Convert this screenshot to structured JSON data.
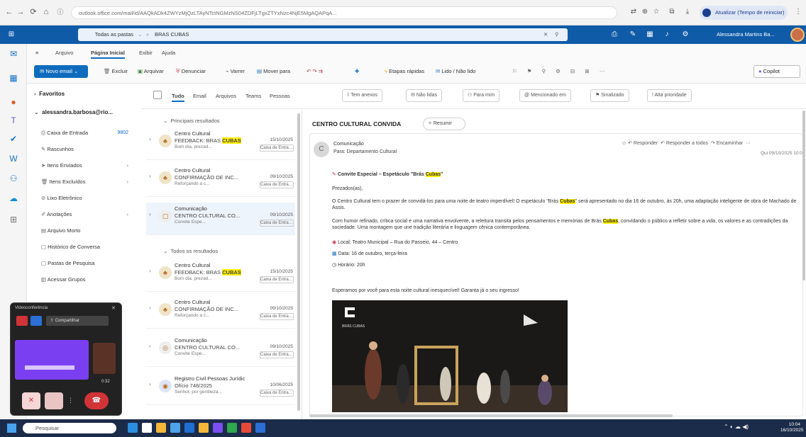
{
  "browser": {
    "nav": {
      "back": "←",
      "forward": "→",
      "reload": "⟳",
      "home": "⌂"
    },
    "address": "outlook.office.com/mail/id/AAQkADk4ZWYzMjQzLTAyNTctNGMzNS04ZDFjLTgxZTYxNzc4NjE5MgAQAPqA...",
    "profile": "Atualizar (Tempo de reiniciar)"
  },
  "header": {
    "search_placeholder": "Todas as pastas",
    "search_query": "BRAS CUBAS",
    "user": "Alessandra Martins Ba..."
  },
  "ribbon": {
    "tabs": [
      "Arquivo",
      "Página Inicial",
      "Exibir",
      "Ajuda"
    ],
    "active_tab": "Página Inicial",
    "new_mail": "Novo email",
    "buttons": [
      "Excluir",
      "Arquivar",
      "Denunciar",
      "Varrer",
      "Mover para",
      "Etapas rápidas",
      "Lido / Não lido"
    ],
    "copilot": "Copilot"
  },
  "folders": {
    "favorites": "Favoritos",
    "account": "alessandra.barbosa@rio...",
    "items": [
      {
        "label": "Caixa de Entrada",
        "count": "9802"
      },
      {
        "label": "Rascunhos",
        "count": ""
      },
      {
        "label": "Itens Enviados",
        "count": ""
      },
      {
        "label": "Itens Excluídos",
        "count": ""
      },
      {
        "label": "Lixo Eletrônico",
        "count": ""
      },
      {
        "label": "Anotações",
        "count": ""
      },
      {
        "label": "Arquivo Morto",
        "count": ""
      },
      {
        "label": "Histórico de Conversa",
        "count": ""
      },
      {
        "label": "Pastas de Pesquisa",
        "count": ""
      },
      {
        "label": "Acessar Grupos",
        "count": ""
      }
    ]
  },
  "filters": {
    "tabs": [
      "Tudo",
      "Email",
      "Arquivos",
      "Teams",
      "Pessoas"
    ],
    "active": "Tudo",
    "chips": [
      "Tem anexos",
      "Não lidas",
      "Para mim",
      "Mencionado em",
      "Sinalizado",
      "Alta prioridade"
    ]
  },
  "list": {
    "group_top": "Principais resultados",
    "group_all": "Todos os resultados",
    "items": [
      {
        "sender": "Centro Cultural",
        "subject_pre": "FEEDBACK: BRAS ",
        "subject_hl": "CUBAS",
        "date": "15/10/2025",
        "preview": "Bom dia, prezad...",
        "tag": "Caixa de Entrada",
        "group": "top"
      },
      {
        "sender": "Centro Cultural",
        "subject_pre": "CONFIRMAÇÃO DE INC...",
        "subject_hl": "",
        "date": "09/10/2025",
        "preview": "Reforçando a c...",
        "tag": "Caixa de Entrada",
        "group": "top"
      },
      {
        "sender": "Comunicação",
        "subject_pre": "CENTRO CULTURAL CO...",
        "subject_hl": "",
        "date": "09/10/2025",
        "preview": "Convite Espe...",
        "tag": "Caixa de Entrada",
        "group": "top"
      },
      {
        "sender": "Centro Cultural",
        "subject_pre": "FEEDBACK: BRAS ",
        "subject_hl": "CUBAS",
        "date": "15/10/2025",
        "preview": "Bom dia, prezad...",
        "tag": "Caixa de Entrada",
        "group": "all"
      },
      {
        "sender": "Centro Cultural",
        "subject_pre": "CONFIRMAÇÃO DE INC...",
        "subject_hl": "",
        "date": "09/10/2025",
        "preview": "Reforçando a c...",
        "tag": "Caixa de Entrada",
        "group": "all"
      },
      {
        "sender": "Comunicação",
        "subject_pre": "CENTRO CULTURAL CO...",
        "subject_hl": "",
        "date": "09/10/2025",
        "preview": "Convite Espe...",
        "tag": "Caixa de Entrada",
        "group": "all"
      },
      {
        "sender": "Registro Civil Pessoas Jurídic",
        "subject_pre": "Ofício 748/2025",
        "subject_hl": "",
        "date": "10/06/2025",
        "preview": "Senhor, por gentileza...",
        "tag": "Caixa de Entrada",
        "group": "all"
      }
    ]
  },
  "reading": {
    "title": "CENTRO CULTURAL CONVIDA",
    "summary_btn": "Resumir",
    "sender": "Comunicação",
    "to": "Para: Departamento Cultural",
    "actions": [
      "Responder",
      "Responder a todos",
      "Encaminhar"
    ],
    "date": "Qui 09/10/2025 10:00",
    "headline_pre": "Convite Especial – Espetáculo \"Brás ",
    "headline_hl": "Cubas",
    "headline_post": "\"",
    "greeting": "Prezados(as),",
    "para1_pre": "O Centro Cultural tem o prazer de convidá-los para uma noite de teatro imperdível! O espetáculo \"Brás ",
    "para1_hl": "Cubas",
    "para1_post": "\" será apresentado no dia 16 de outubro, às 20h, uma adaptação inteligente de obra de Machado de Assis.",
    "para2_pre": "Com humor refinado, crítica social e uma narrativa envolvente, a releitura transita pelos pensamentos e memórias de Brás ",
    "para2_hl": "Cubas",
    "para2_post": ", convidando o público a refletir sobre a vida, os valores e as contradições da sociedade. Uma montagem que une tradição literária e linguagem cênica contemporânea.",
    "local": "Local: Teatro Municipal – Rua do Passeio, 44 – Centro",
    "data": "Data: 16 de outubro, terça-feira",
    "horario": "Horário: 20h",
    "closing": "Esperamos por você para esta noite cultural inesquecível! Garanta já o seu ingresso!",
    "photo_label": "BRÁS CUBAS"
  },
  "call": {
    "title": "Videoconferência",
    "share_label": "Compartilhar",
    "timer": "0:32"
  },
  "taskbar": {
    "search": "Pesquisar",
    "time": "10:04",
    "date": "16/10/2025"
  },
  "colors": {
    "outlook_blue": "#0f5ba8",
    "accent": "#0f6cbd",
    "highlight": "#ffee00",
    "call_red": "#d13438",
    "taskbar": "#1b2b4a"
  }
}
